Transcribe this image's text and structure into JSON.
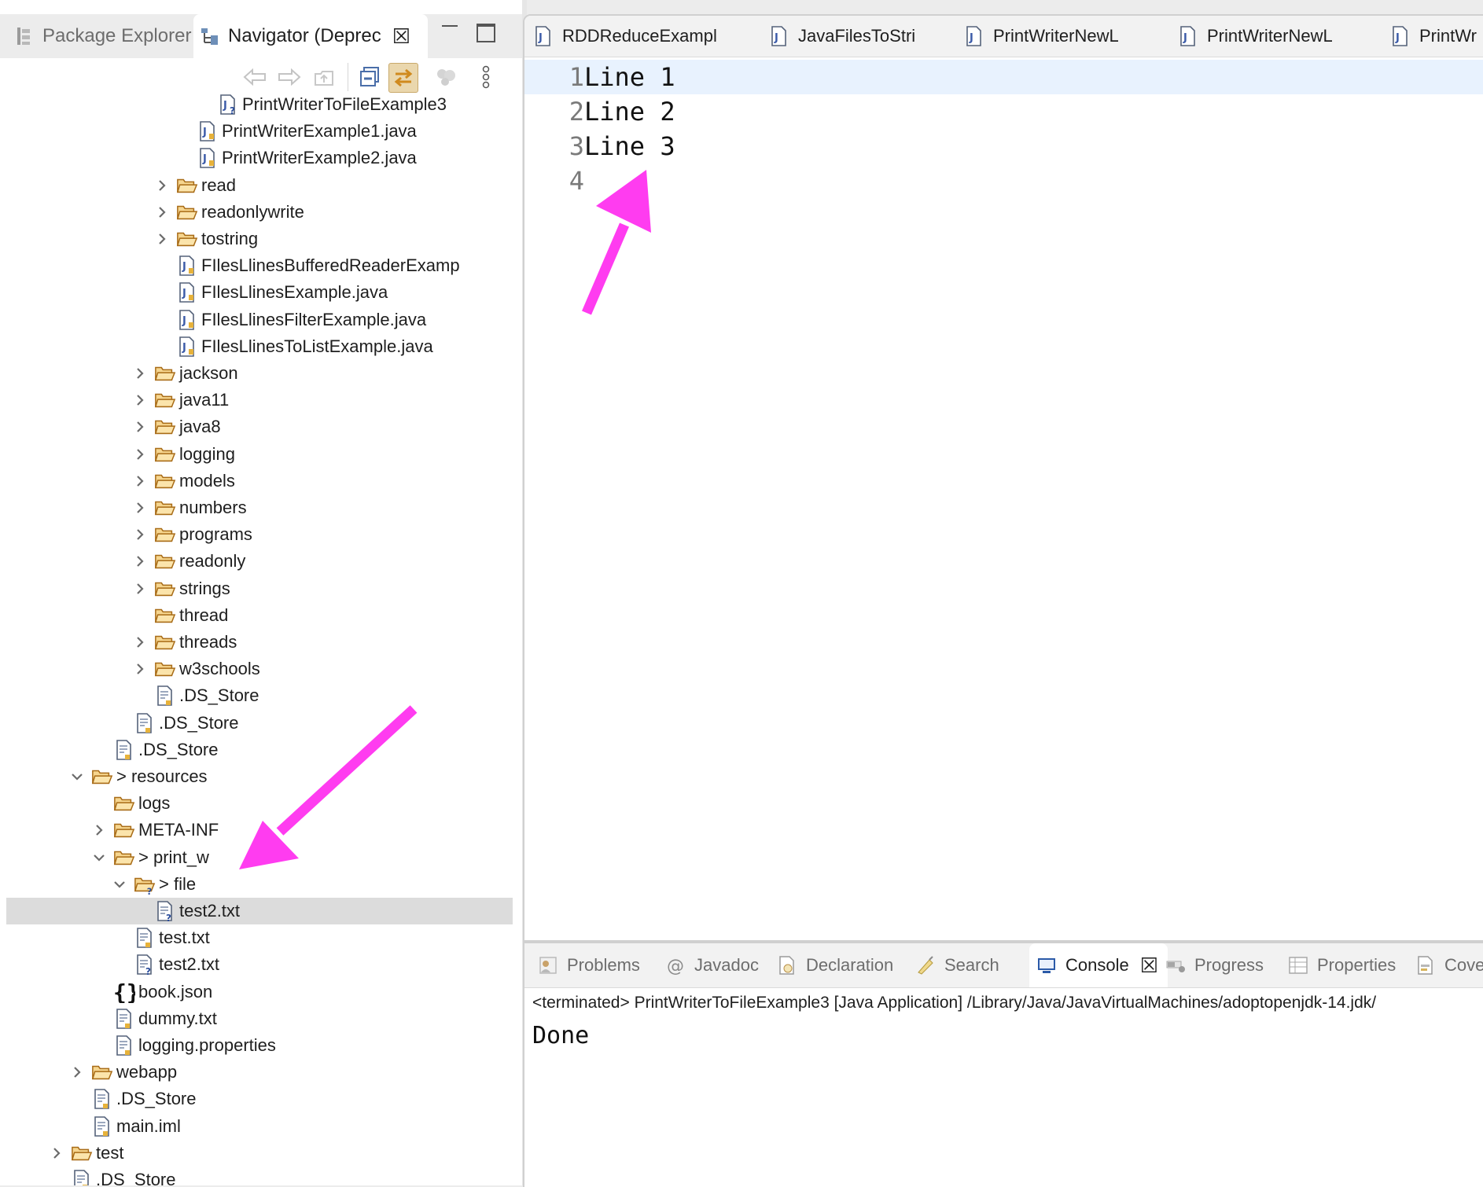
{
  "left_tabs": {
    "package_explorer": "Package Explorer",
    "navigator": "Navigator (Deprec",
    "close_symbol": "☒"
  },
  "tree": [
    {
      "label": "PrintWriterToFileExample3",
      "icon": "java-file-unknown-icon",
      "expand": "none"
    },
    {
      "label": "PrintWriterExample1.java",
      "icon": "java-file-icon",
      "expand": "none"
    },
    {
      "label": "PrintWriterExample2.java",
      "icon": "java-file-icon",
      "expand": "none"
    },
    {
      "label": "read",
      "icon": "folder-icon",
      "expand": "collapsed"
    },
    {
      "label": "readonlywrite",
      "icon": "folder-icon",
      "expand": "collapsed"
    },
    {
      "label": "tostring",
      "icon": "folder-icon",
      "expand": "collapsed"
    },
    {
      "label": "FIlesLlinesBufferedReaderExamp",
      "icon": "java-file-icon",
      "expand": "none"
    },
    {
      "label": "FIlesLlinesExample.java",
      "icon": "java-file-icon",
      "expand": "none"
    },
    {
      "label": "FIlesLlinesFilterExample.java",
      "icon": "java-file-icon",
      "expand": "none"
    },
    {
      "label": "FIlesLlinesToListExample.java",
      "icon": "java-file-icon",
      "expand": "none"
    },
    {
      "label": "jackson",
      "icon": "folder-icon",
      "expand": "collapsed"
    },
    {
      "label": "java11",
      "icon": "folder-icon",
      "expand": "collapsed"
    },
    {
      "label": "java8",
      "icon": "folder-icon",
      "expand": "collapsed"
    },
    {
      "label": "logging",
      "icon": "folder-icon",
      "expand": "collapsed"
    },
    {
      "label": "models",
      "icon": "folder-icon",
      "expand": "collapsed"
    },
    {
      "label": "numbers",
      "icon": "folder-icon",
      "expand": "collapsed"
    },
    {
      "label": "programs",
      "icon": "folder-icon",
      "expand": "collapsed"
    },
    {
      "label": "readonly",
      "icon": "folder-icon",
      "expand": "collapsed"
    },
    {
      "label": "strings",
      "icon": "folder-icon",
      "expand": "collapsed"
    },
    {
      "label": "thread",
      "icon": "folder-icon",
      "expand": "none"
    },
    {
      "label": "threads",
      "icon": "folder-icon",
      "expand": "collapsed"
    },
    {
      "label": "w3schools",
      "icon": "folder-icon",
      "expand": "collapsed"
    },
    {
      "label": ".DS_Store",
      "icon": "text-file-icon",
      "expand": "none"
    },
    {
      "label": ".DS_Store",
      "icon": "text-file-icon",
      "expand": "none"
    },
    {
      "label": ".DS_Store",
      "icon": "text-file-icon",
      "expand": "none"
    },
    {
      "label": "> resources",
      "icon": "folder-icon",
      "expand": "expanded"
    },
    {
      "label": "logs",
      "icon": "folder-icon",
      "expand": "none"
    },
    {
      "label": "META-INF",
      "icon": "folder-icon",
      "expand": "collapsed"
    },
    {
      "label": "> print_w",
      "icon": "folder-icon",
      "expand": "expanded"
    },
    {
      "label": "> file",
      "icon": "folder-unknown-icon",
      "expand": "expanded"
    },
    {
      "label": "test2.txt",
      "icon": "text-file-unknown-icon",
      "expand": "none",
      "selected": true
    },
    {
      "label": "test.txt",
      "icon": "text-file-icon",
      "expand": "none"
    },
    {
      "label": "test2.txt",
      "icon": "text-file-unknown-icon",
      "expand": "none"
    },
    {
      "label": "book.json",
      "icon": "json-file-icon",
      "expand": "none"
    },
    {
      "label": "dummy.txt",
      "icon": "text-file-icon",
      "expand": "none"
    },
    {
      "label": "logging.properties",
      "icon": "text-file-icon",
      "expand": "none"
    },
    {
      "label": "webapp",
      "icon": "folder-icon",
      "expand": "collapsed"
    },
    {
      "label": ".DS_Store",
      "icon": "text-file-icon",
      "expand": "none"
    },
    {
      "label": "main.iml",
      "icon": "text-file-icon",
      "expand": "none"
    },
    {
      "label": "test",
      "icon": "folder-icon",
      "expand": "collapsed"
    },
    {
      "label": ".DS_Store",
      "icon": "text-file-icon",
      "expand": "none"
    }
  ],
  "editor_tabs": [
    "RDDReduceExampl",
    "JavaFilesToStri",
    "PrintWriterNewL",
    "PrintWriterNewL",
    "PrintWr"
  ],
  "code_lines": [
    {
      "num": "1",
      "text": "Line 1"
    },
    {
      "num": "2",
      "text": "Line 2"
    },
    {
      "num": "3",
      "text": "Line 3"
    },
    {
      "num": "4",
      "text": ""
    }
  ],
  "bottom_tabs": [
    "Problems",
    "Javadoc",
    "Declaration",
    "Search",
    "Console",
    "Progress",
    "Properties",
    "Cove"
  ],
  "console": {
    "status": "<terminated> PrintWriterToFileExample3 [Java Application] /Library/Java/JavaVirtualMachines/adoptopenjdk-14.jdk/",
    "output": "Done"
  },
  "colors": {
    "annotation_arrow": "#ff3cf0",
    "selection": "#dcdcdc",
    "current_line": "#e8f2fe",
    "folder": "#e8a33a"
  }
}
